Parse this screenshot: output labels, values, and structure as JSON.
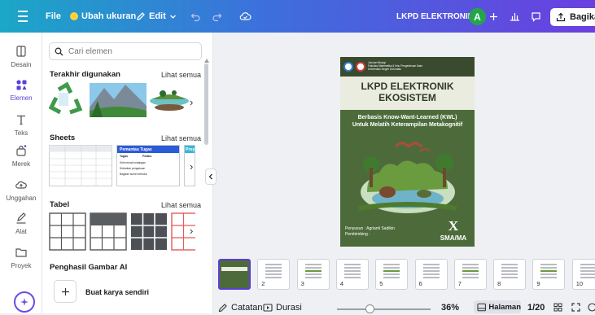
{
  "topbar": {
    "menu_icon": "hamburger-icon",
    "file_label": "File",
    "resize_label": "Ubah ukuran",
    "edit_label": "Edit",
    "doc_title": "LKPD ELEKTRONIK",
    "avatar_initial": "A",
    "share_label": "Bagikan",
    "colors": {
      "gradient_start": "#1ba7c7",
      "gradient_end": "#6b3fe0",
      "avatar": "#23a64a"
    }
  },
  "rail": {
    "items": [
      {
        "label": "Desain",
        "icon": "design-icon"
      },
      {
        "label": "Elemen",
        "icon": "elements-icon"
      },
      {
        "label": "Teks",
        "icon": "text-icon"
      },
      {
        "label": "Merek",
        "icon": "brand-icon"
      },
      {
        "label": "Unggahan",
        "icon": "upload-icon"
      },
      {
        "label": "Alat",
        "icon": "draw-icon"
      },
      {
        "label": "Proyek",
        "icon": "folder-icon"
      }
    ],
    "magic_icon": "magic-sparkle-icon",
    "accent": "#5b3fd6"
  },
  "panel": {
    "search_placeholder": "Cari elemen",
    "sections": {
      "recent": {
        "title": "Terakhir digunakan",
        "see_all": "Lihat semua"
      },
      "sheets": {
        "title": "Sheets",
        "see_all": "Lihat semua",
        "card_header": "Pemantau Tugas",
        "card_cols": [
          "Tugas",
          "Pelaku",
          "Prog"
        ],
        "card_rows": [
          "Kirim email undangan",
          "Sebarkan pengakuan",
          "Bagikan survei terbuka"
        ],
        "card2_header": "Proy"
      },
      "tables": {
        "title": "Tabel",
        "see_all": "Lihat semua"
      },
      "ai": {
        "title": "Penghasil Gambar AI",
        "generate_label": "Buat karya sendiri"
      }
    }
  },
  "page": {
    "institution_lines": [
      "Jurusan Biologi",
      "Fakultas Matematika & Ilmu Pengetahuan Alam",
      "Universitas Negeri Gorontalo"
    ],
    "title_1": "LKPD ELEKTRONIK",
    "title_2": "EKOSISTEM",
    "subtitle_1": "Berbasis Know-Want-Learned (KWL)",
    "subtitle_2": "Untuk Melatih Keterampilan Metakognitif",
    "author_line": "Penyusun    : Agrianti Sadikin",
    "advisor_line": "Pembimbing :",
    "grade_numeral": "X",
    "grade_school": "SMA/MA",
    "colors": {
      "bg": "#4d6b3a",
      "band": "#e9ecdf",
      "title": "#2f3b27"
    }
  },
  "thumbnails": [
    "",
    "2",
    "3",
    "4",
    "5",
    "6",
    "7",
    "8",
    "9",
    "10"
  ],
  "bottombar": {
    "notes_label": "Catatan",
    "duration_label": "Durasi",
    "zoom_value": 36,
    "zoom_label": "36%",
    "pages_label": "Halaman",
    "page_counter": "1/20"
  }
}
